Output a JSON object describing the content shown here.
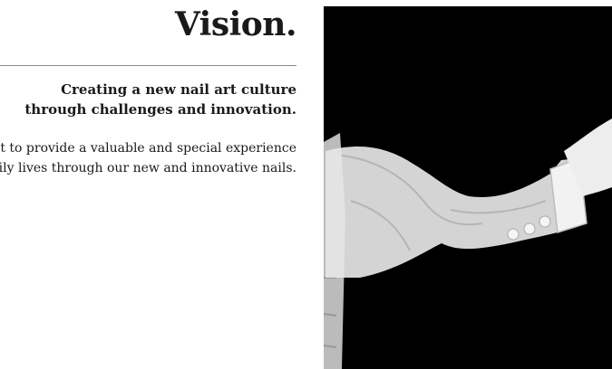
{
  "vision": {
    "title": "Vision.",
    "subhead_line1": "Creating a new nail art culture",
    "subhead_line2": "through challenges and innovation.",
    "body_line1": "want to provide a valuable and special experience",
    "body_line2": "' daily lives through our new and innovative nails."
  },
  "image": {
    "subject": "sleeve-arm-photo",
    "background_color": "#000000"
  }
}
